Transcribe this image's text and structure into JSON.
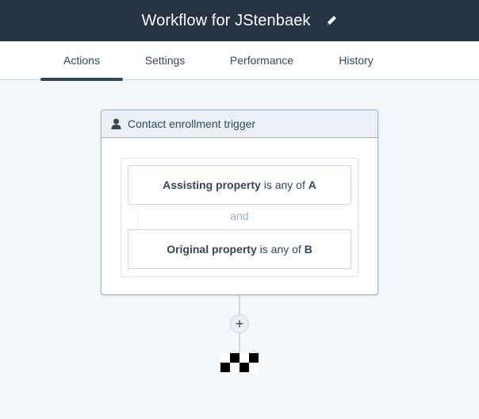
{
  "header": {
    "title": "Workflow for JStenbaek",
    "edit_icon": "pencil-icon"
  },
  "tabs": [
    {
      "label": "Actions",
      "active": true
    },
    {
      "label": "Settings",
      "active": false
    },
    {
      "label": "Performance",
      "active": false
    },
    {
      "label": "History",
      "active": false
    }
  ],
  "trigger": {
    "icon": "person-icon",
    "title": "Contact enrollment trigger",
    "filters": [
      {
        "property": "Assisting property",
        "operator": "is any of",
        "value": "A"
      },
      {
        "property": "Original property",
        "operator": "is any of",
        "value": "B"
      }
    ],
    "joiner": "and"
  },
  "add_action": {
    "icon": "plus-icon",
    "label": "+"
  },
  "end": {
    "icon": "checkered-flag-icon"
  },
  "colors": {
    "topbar": "#253342",
    "page_bg": "#f5f8fa",
    "text": "#33475b",
    "card_header": "#eaf0f6",
    "border": "#99afc4"
  }
}
